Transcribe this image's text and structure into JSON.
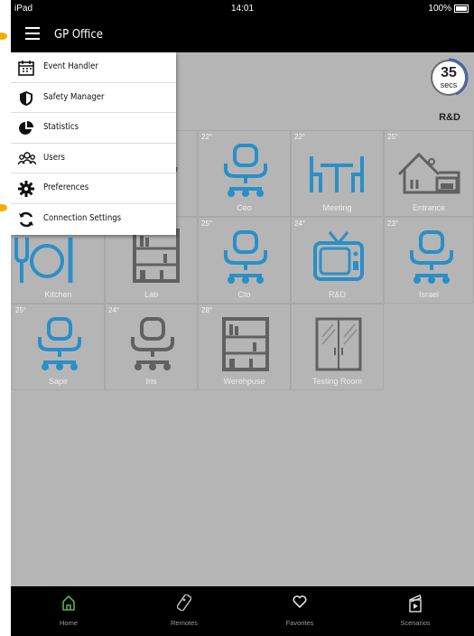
{
  "status": {
    "device": "iPad",
    "time": "14:01",
    "battery": "100%"
  },
  "header": {
    "title": "GP Office"
  },
  "timer": {
    "value": "35",
    "unit": "secs",
    "label": "R&D"
  },
  "menu": {
    "items": [
      {
        "label": "Event Handler",
        "icon": "calendar-icon"
      },
      {
        "label": "Safety Manager",
        "icon": "shield-icon"
      },
      {
        "label": "Statistics",
        "icon": "pie-chart-icon"
      },
      {
        "label": "Users",
        "icon": "users-icon"
      },
      {
        "label": "Preferences",
        "icon": "gear-icon"
      },
      {
        "label": "Connection Settings",
        "icon": "refresh-icon"
      }
    ]
  },
  "rooms": [
    {
      "name": "",
      "temp": "",
      "icon": "hidden"
    },
    {
      "name": "",
      "temp": "",
      "icon": "chair-icon"
    },
    {
      "name": "Ceo",
      "temp": "22°",
      "icon": "chair-icon"
    },
    {
      "name": "Meeting",
      "temp": "22°",
      "icon": "table-icon"
    },
    {
      "name": "Entrance",
      "temp": "25°",
      "icon": "house-icon"
    },
    {
      "name": "Kitchen",
      "temp": "",
      "icon": "utensils-icon"
    },
    {
      "name": "Lab",
      "temp": "",
      "icon": "bookshelf-icon"
    },
    {
      "name": "Cto",
      "temp": "25°",
      "icon": "chair-icon"
    },
    {
      "name": "R&D",
      "temp": "24°",
      "icon": "tv-icon"
    },
    {
      "name": "Israel",
      "temp": "23°",
      "icon": "chair-icon"
    },
    {
      "name": "Sapir",
      "temp": "25°",
      "icon": "chair-icon"
    },
    {
      "name": "Iris",
      "temp": "24°",
      "icon": "chair-icon"
    },
    {
      "name": "Werehpuse",
      "temp": "28°",
      "icon": "bookshelf-icon"
    },
    {
      "name": "Testing Room",
      "temp": "",
      "icon": "cabinet-icon"
    }
  ],
  "tabs": [
    {
      "label": "Home",
      "icon": "home-icon"
    },
    {
      "label": "Remotes",
      "icon": "remote-icon"
    },
    {
      "label": "Favorites",
      "icon": "heart-icon"
    },
    {
      "label": "Scenarios",
      "icon": "clapper-icon"
    }
  ],
  "colors": {
    "accent": "#2a8fc8",
    "active_tab": "#58b24a",
    "callout": "#f0ae00"
  }
}
